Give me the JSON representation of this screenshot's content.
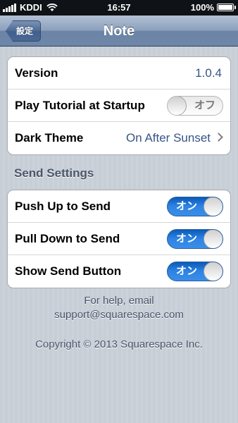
{
  "status_bar": {
    "carrier": "KDDI",
    "time": "16:57",
    "battery": "100%"
  },
  "nav": {
    "back_label": "設定",
    "title": "Note"
  },
  "general": {
    "version_label": "Version",
    "version_value": "1.0.4",
    "tutorial_label": "Play Tutorial at Startup",
    "tutorial_toggle": "オフ",
    "dark_theme_label": "Dark Theme",
    "dark_theme_value": "On After Sunset"
  },
  "send_settings": {
    "header": "Send Settings",
    "push_up_label": "Push Up to Send",
    "push_up_toggle": "オン",
    "pull_down_label": "Pull Down to Send",
    "pull_down_toggle": "オン",
    "show_button_label": "Show Send Button",
    "show_button_toggle": "オン"
  },
  "footer": {
    "help_line1": "For help, email",
    "help_line2": "support@squarespace.com",
    "copyright": "Copyright © 2013 Squarespace Inc."
  },
  "colors": {
    "accent_value": "#385487",
    "toggle_on": "#2f84e4",
    "background": "#c5ccd4"
  }
}
